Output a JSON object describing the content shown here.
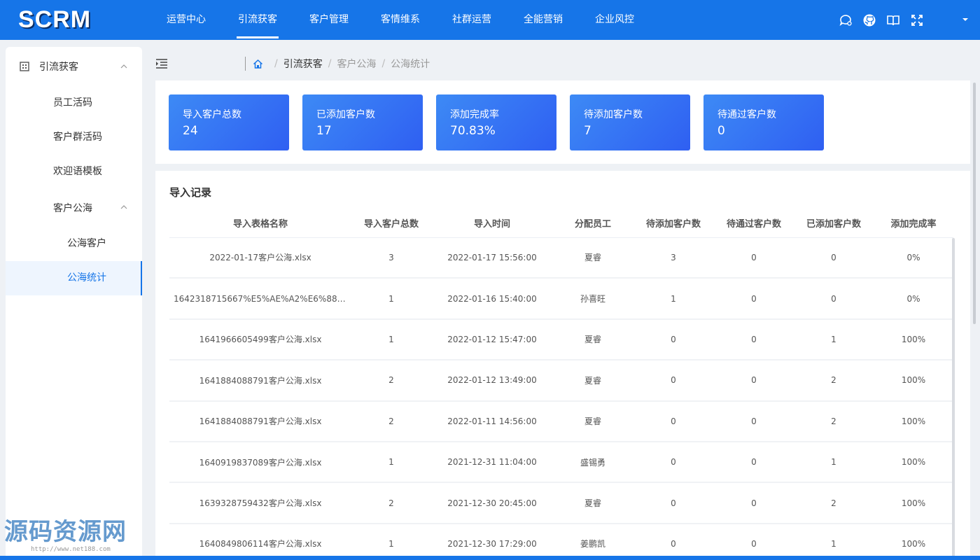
{
  "app": {
    "logo": "SCRM"
  },
  "nav": [
    "运营中心",
    "引流获客",
    "客户管理",
    "客情维系",
    "社群运营",
    "全能营销",
    "企业风控"
  ],
  "nav_active_index": 1,
  "top_icons": [
    "chat-icon",
    "github-icon",
    "book-icon",
    "fullscreen-icon",
    "chevron-down-icon"
  ],
  "sidebar": {
    "group_label": "引流获客",
    "items": [
      "员工活码",
      "客户群活码",
      "欢迎语模板"
    ],
    "subgroup_label": "客户公海",
    "subitems": [
      "公海客户",
      "公海统计"
    ],
    "active_subitem_index": 1
  },
  "breadcrumb": [
    "引流获客",
    "客户公海",
    "公海统计"
  ],
  "stats": [
    {
      "label": "导入客户总数",
      "value": "24"
    },
    {
      "label": "已添加客户数",
      "value": "17"
    },
    {
      "label": "添加完成率",
      "value": "70.83%"
    },
    {
      "label": "待添加客户数",
      "value": "7"
    },
    {
      "label": "待通过客户数",
      "value": "0"
    }
  ],
  "records": {
    "title": "导入记录",
    "columns": [
      "导入表格名称",
      "导入客户总数",
      "导入时间",
      "分配员工",
      "待添加客户数",
      "待通过客户数",
      "已添加客户数",
      "添加完成率"
    ],
    "rows": [
      [
        "2022-01-17客户公海.xlsx",
        "3",
        "2022-01-17 15:56:00",
        "夏睿",
        "3",
        "0",
        "0",
        "0%"
      ],
      [
        "1642318715667%E5%AE%A2%E6%88%B...",
        "1",
        "2022-01-16 15:40:00",
        "孙喜旺",
        "1",
        "0",
        "0",
        "0%"
      ],
      [
        "1641966605499客户公海.xlsx",
        "1",
        "2022-01-12 15:47:00",
        "夏睿",
        "0",
        "0",
        "1",
        "100%"
      ],
      [
        "1641884088791客户公海.xlsx",
        "2",
        "2022-01-12 13:49:00",
        "夏睿",
        "0",
        "0",
        "2",
        "100%"
      ],
      [
        "1641884088791客户公海.xlsx",
        "2",
        "2022-01-11 14:56:00",
        "夏睿",
        "0",
        "0",
        "2",
        "100%"
      ],
      [
        "1640919837089客户公海.xlsx",
        "1",
        "2021-12-31 11:04:00",
        "盛锡勇",
        "0",
        "0",
        "1",
        "100%"
      ],
      [
        "1639328759432客户公海.xlsx",
        "2",
        "2021-12-30 20:45:00",
        "夏睿",
        "0",
        "0",
        "2",
        "100%"
      ],
      [
        "1640849806114客户公海.xlsx",
        "1",
        "2021-12-30 17:29:00",
        "姜鹏凯",
        "0",
        "0",
        "1",
        "100%"
      ]
    ]
  },
  "watermark": {
    "text": "源码资源网",
    "url": "http://www.net188.com"
  },
  "colors": {
    "brand": "#1675e8",
    "card_start": "#3d8af5",
    "card_end": "#2f5ff2"
  }
}
